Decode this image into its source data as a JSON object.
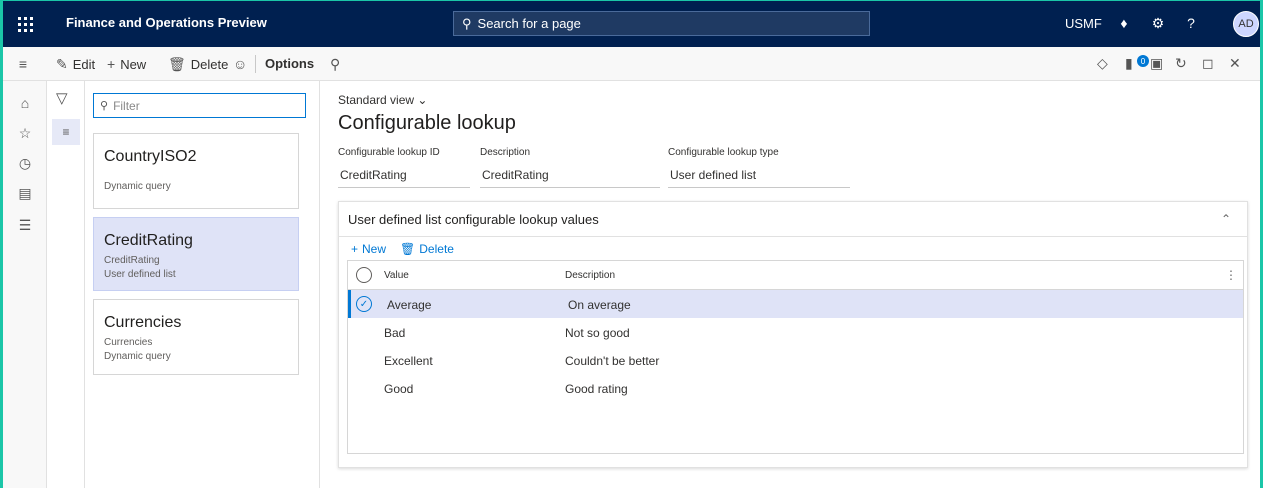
{
  "app": {
    "title": "Finance and Operations Preview",
    "company": "USMF",
    "user_initials": "AD"
  },
  "search": {
    "placeholder": "Search for a page"
  },
  "toolbar": {
    "edit_label": "Edit",
    "new_label": "New",
    "delete_label": "Delete",
    "options_label": "Options",
    "notification_count": "0"
  },
  "filter": {
    "placeholder": "Filter"
  },
  "list": [
    {
      "title": "CountryISO2",
      "line1": "",
      "line2": "Dynamic query"
    },
    {
      "title": "CreditRating",
      "line1": "CreditRating",
      "line2": "User defined list"
    },
    {
      "title": "Currencies",
      "line1": "Currencies",
      "line2": "Dynamic query"
    }
  ],
  "page": {
    "view_label": "Standard view",
    "title": "Configurable lookup",
    "fields": [
      {
        "label": "Configurable lookup ID",
        "value": "CreditRating"
      },
      {
        "label": "Description",
        "value": "CreditRating"
      },
      {
        "label": "Configurable lookup type",
        "value": "User defined list"
      }
    ]
  },
  "panel": {
    "title": "User defined list configurable lookup values",
    "new_label": "New",
    "delete_label": "Delete",
    "columns": {
      "value": "Value",
      "description": "Description"
    },
    "rows": [
      {
        "value": "Average",
        "description": "On average"
      },
      {
        "value": "Bad",
        "description": "Not so good"
      },
      {
        "value": "Excellent",
        "description": "Couldn't be better"
      },
      {
        "value": "Good",
        "description": "Good rating"
      }
    ]
  },
  "colors": {
    "topbar": "#002050",
    "accent": "#0078d4",
    "selected": "#dfe3f7",
    "frame": "#1bc6a8"
  }
}
